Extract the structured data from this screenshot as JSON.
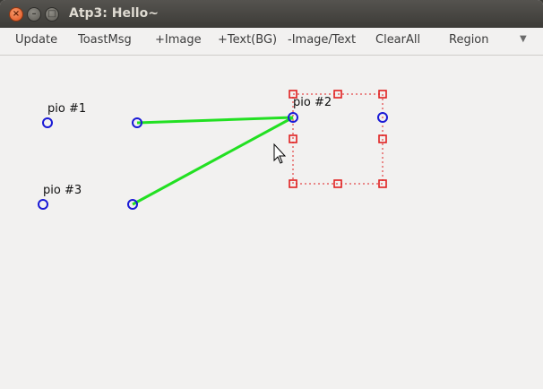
{
  "window": {
    "title": "Atp3: Hello~",
    "controls": {
      "close": "×",
      "minimize": "–",
      "maximize": "□"
    }
  },
  "menu": {
    "items": [
      "Update",
      "ToastMsg",
      "+Image",
      "+Text(BG)",
      "-Image/Text",
      "ClearAll",
      "Region"
    ],
    "overflow_icon": "chevron-down-icon"
  },
  "canvas": {
    "pios": [
      {
        "label": "pio #1"
      },
      {
        "label": "pio #2"
      },
      {
        "label": "pio #3"
      }
    ],
    "colors": {
      "pio": "#1a1ad6",
      "link": "#22e022",
      "selection": "#e02020"
    }
  }
}
